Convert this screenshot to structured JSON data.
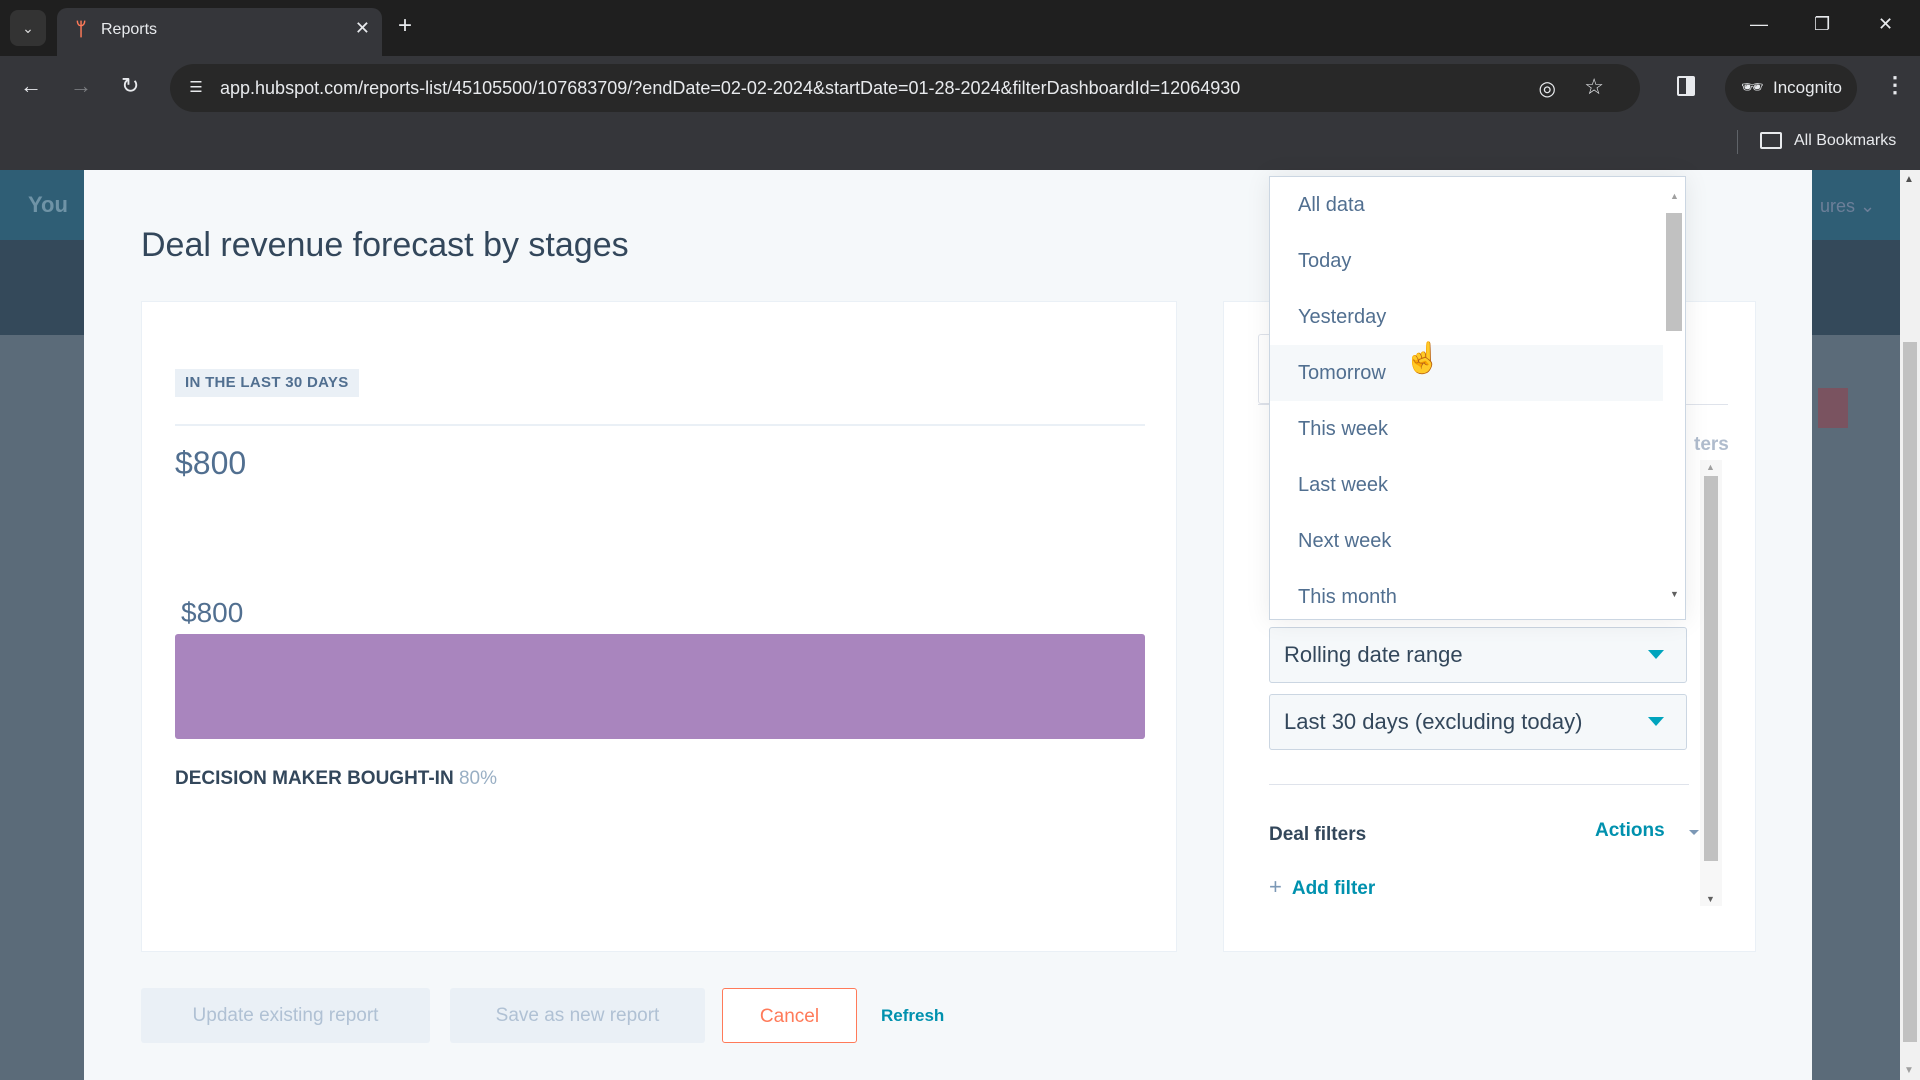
{
  "browser": {
    "tab_title": "Reports",
    "url": "app.hubspot.com/reports-list/45105500/107683709/?endDate=02-02-2024&startDate=01-28-2024&filterDashboardId=12064930",
    "incognito_label": "Incognito",
    "bookmarks_label": "All Bookmarks",
    "icons": {
      "tab_list": "⌄",
      "favicon": "hubspot-sprocket",
      "close": "✕",
      "new_tab": "+",
      "back": "←",
      "forward": "→",
      "reload": "↻",
      "minimize": "—",
      "restore": "❐",
      "window_close": "✕",
      "eye_off": "◎",
      "star": "☆",
      "incognito": "🕶",
      "menu": "⋮"
    }
  },
  "background": {
    "header_text": "You",
    "header_right_text": "ures ⌄"
  },
  "report": {
    "title": "Deal revenue forecast by stages",
    "date_badge": "IN THE LAST 30 DAYS",
    "total_value": "$800"
  },
  "chart_data": {
    "type": "bar",
    "orientation": "horizontal",
    "title": "Deal revenue forecast by stages",
    "categories": [
      "DECISION MAKER BOUGHT-IN"
    ],
    "category_probabilities": [
      "80%"
    ],
    "values": [
      800
    ],
    "value_labels": [
      "$800"
    ],
    "color": "#a985be",
    "xlim": [
      0,
      800
    ],
    "grid": false,
    "legend": "none"
  },
  "settings": {
    "filters_ghost_text": "ters",
    "date_range_type": "Rolling date range",
    "date_range_value": "Last 30 days (excluding today)",
    "deal_filters_label": "Deal filters",
    "actions_label": "Actions",
    "add_filter_label": "Add filter",
    "add_filter_icon": "+"
  },
  "dropdown": {
    "options": [
      "All data",
      "Today",
      "Yesterday",
      "Tomorrow",
      "This week",
      "Last week",
      "Next week",
      "This month"
    ],
    "hovered": "Tomorrow"
  },
  "footer": {
    "update_label": "Update existing report",
    "save_new_label": "Save as new report",
    "cancel_label": "Cancel",
    "refresh_label": "Refresh"
  },
  "colors": {
    "accent": "#0091ae",
    "cancel": "#ff7a59",
    "bar": "#a985be",
    "text": "#33475b"
  }
}
